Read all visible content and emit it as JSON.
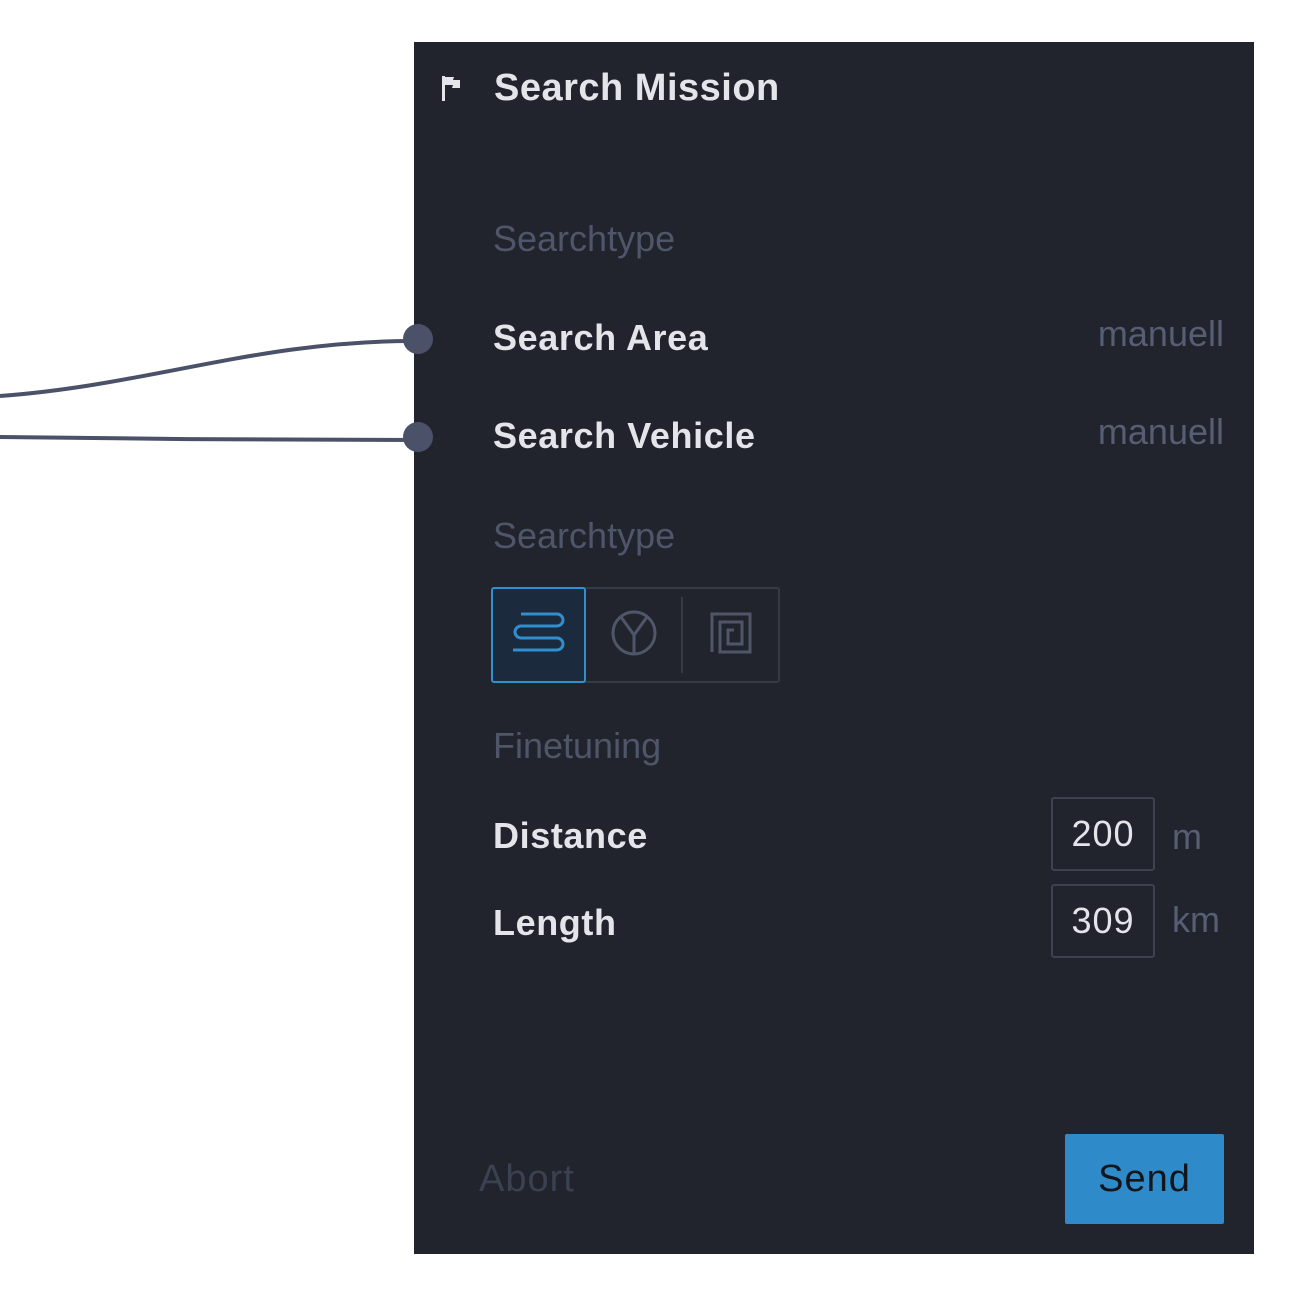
{
  "panel": {
    "title": "Search Mission",
    "icon": "flag-icon"
  },
  "searchtype_section": {
    "label": "Searchtype",
    "rows": [
      {
        "label": "Search Area",
        "value": "manuell",
        "connected": true
      },
      {
        "label": "Search Vehicle",
        "value": "manuell",
        "connected": true
      }
    ]
  },
  "pattern_section": {
    "label": "Searchtype",
    "options": [
      {
        "icon": "lawnmower-pattern-icon",
        "selected": true
      },
      {
        "icon": "sector-pattern-icon",
        "selected": false
      },
      {
        "icon": "spiral-pattern-icon",
        "selected": false
      }
    ]
  },
  "finetuning_section": {
    "label": "Finetuning",
    "fields": [
      {
        "label": "Distance",
        "value": "200",
        "unit": "m"
      },
      {
        "label": "Length",
        "value": "309",
        "unit": "km"
      }
    ]
  },
  "actions": {
    "abort_label": "Abort",
    "send_label": "Send"
  },
  "colors": {
    "panel_bg": "#21242c",
    "accent": "#2e8ac8",
    "wire": "#4a5168",
    "text": "#e3e5ea",
    "muted": "#4f5669"
  }
}
